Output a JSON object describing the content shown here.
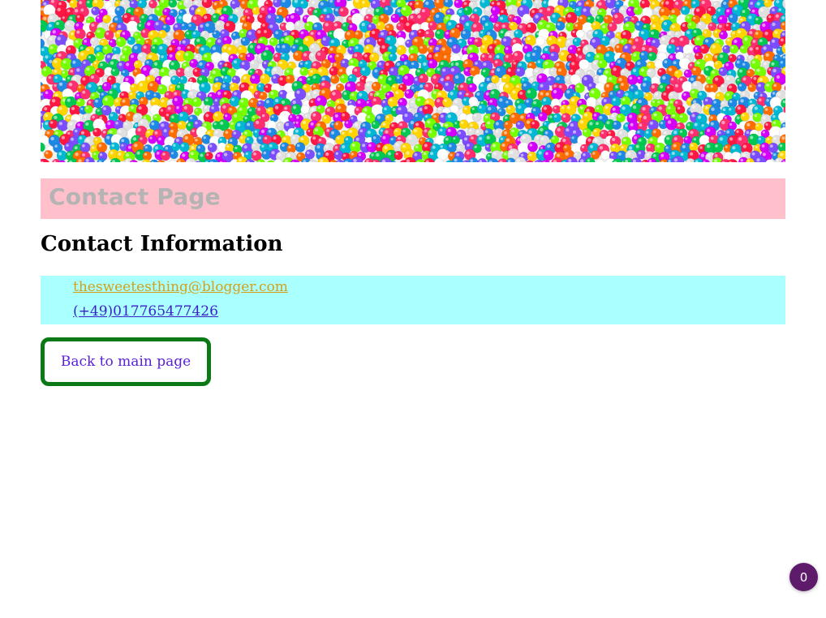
{
  "hero": {
    "image_name": "colorful-balls-photo",
    "palette": [
      "#ff2e6e",
      "#ffd400",
      "#00c853",
      "#1e88e5",
      "#00b8d4",
      "#ff6d00",
      "#d500f9",
      "#e0e0e0",
      "#ffffff",
      "#7c4dff",
      "#ff1744",
      "#76ff03"
    ]
  },
  "banner": {
    "title": "Contact Page",
    "background": "#ffc0cb"
  },
  "section": {
    "heading": "Contact Information"
  },
  "contact": {
    "email": "thesweetesthing@blogger.com",
    "phone": "(+49)017765477426",
    "background": "#aaffff"
  },
  "navigation": {
    "back_label": "Back to main page"
  },
  "badge": {
    "count": "0"
  }
}
